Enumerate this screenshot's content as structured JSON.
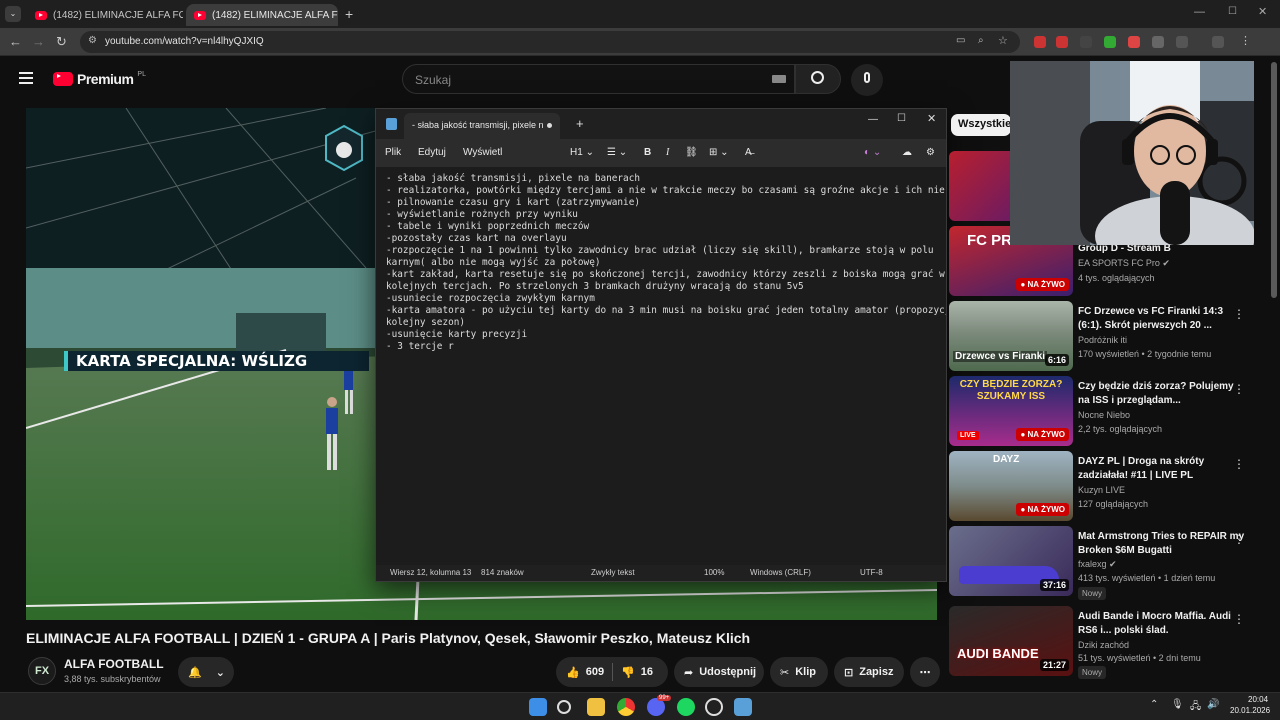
{
  "browser": {
    "tabs": [
      {
        "title": "(1482) ELIMINACJE ALFA FO",
        "active": false
      },
      {
        "title": "(1482) ELIMINACJE ALFA FOOTB",
        "active": true
      }
    ],
    "url": "youtube.com/watch?v=nl4lhyQJXIQ"
  },
  "youtube": {
    "logo": "Premium",
    "region": "PL",
    "search_placeholder": "Szukaj",
    "video_title": "ELIMINACJE ALFA FOOTBALL | DZIEŃ 1 - GRUPA A | Paris Platynov, Qesek, Sławomir Peszko, Mateusz Klich",
    "channel": {
      "name": "ALFA FOOTBALL",
      "subs": "3,88 tys. subskrybentów",
      "avatar_text": "FX"
    },
    "likes": "609",
    "dislikes": "16",
    "share_label": "Udostępnij",
    "clip_label": "Klip",
    "save_label": "Zapisz",
    "overlay_text": "KARTA SPECJALNA: WŚLIZG",
    "filter_chip": "Wszystkie"
  },
  "notepad": {
    "tab_title": "- słaba jakość transmisji, pixele n",
    "menu": [
      "Plik",
      "Edytuj",
      "Wyświetl"
    ],
    "heading_sel": "H1",
    "text": "- słaba jakość transmisji, pixele na banerach\n- realizatorka, powtórki między tercjami a nie w trakcie meczy bo czasami są groźne akcje i ich nie widać\n- pilnowanie czasu gry i kart (zatrzymywanie)\n- wyświetlanie rożnych przy wyniku\n- tabele i wyniki poprzednich meczów\n-pozostały czas kart na overlayu\n-rozpoczęcie 1 na 1 powinni tylko zawodnicy brac udział (liczy się skill), bramkarze stoją w polu\nkarnym( albo nie mogą wyjść za połowę)\n-kart zakład, karta resetuje się po skończonej tercji, zawodnicy którzy zeszli z boiska mogą grać w\nkolejnych tercjach. Po strzelonych 3 bramkach drużyny wracają do stanu 5v5\n-usuniecie rozpoczęcia zwykłym karnym\n-karta amatora - po użyciu tej karty do na 3 min musi na boisku grać jeden totalny amator (propozycja na\nkolejny sezon)\n-usunięcie karty precyzji\n- 3 tercje r",
    "status": {
      "position": "Wiersz 12, kolumna 13",
      "chars": "814 znaków",
      "format": "Zwykły tekst",
      "zoom": "100%",
      "eol": "Windows (CRLF)",
      "encoding": "UTF-8"
    }
  },
  "sidebar": [
    {
      "title": "Group D - Stream B",
      "channel": "EA SPORTS FC Pro",
      "verified": true,
      "meta": "4 tys. oglądających",
      "badge": "",
      "thumb_text": "FC PRO",
      "colors": [
        "#b81f2e",
        "#4a1a7a"
      ]
    },
    {
      "title": "FC Drzewce vs FC Firanki 14:3 (6:1). Skrót pierwszych 20 ...",
      "channel": "Podróżnik iti",
      "verified": false,
      "meta": "170 wyświetleń • 2 tygodnie temu",
      "badge": "6:16",
      "thumb_text": "Drzewce vs Firanki",
      "colors": [
        "#9aa89a",
        "#556655"
      ]
    },
    {
      "title": "Czy będzie dziś zorza? Polujemy na ISS i przeglądam...",
      "channel": "Nocne Niebo",
      "verified": false,
      "meta": "2,2 tys. oglądających",
      "badge": "NA ŻYWO",
      "thumb_text": "CZY BĘDZIE ZORZA? SZUKAMY ISS",
      "colors": [
        "#1d2a6b",
        "#a82c8c"
      ]
    },
    {
      "title": "DAYZ PL | Droga na skróty zadziałała! #11 | LIVE PL",
      "channel": "Kuzyn LIVE",
      "verified": false,
      "meta": "127 oglądających",
      "badge": "NA ŻYWO",
      "thumb_text": "DAYZ",
      "colors": [
        "#8aa0b0",
        "#6a5a3a"
      ]
    },
    {
      "title": "Mat Armstrong Tries to REPAIR my Broken $6M Bugatti",
      "channel": "fxalexg",
      "verified": true,
      "meta": "413 tys. wyświetleń • 1 dzień temu",
      "badge": "37:16",
      "new": "Nowy",
      "thumb_text": "",
      "colors": [
        "#6a6e8c",
        "#3a2a5a"
      ]
    },
    {
      "title": "Audi Bande i Mocro Maffia. Audi RS6 i... polski ślad.",
      "channel": "Dziki zachód",
      "verified": false,
      "meta": "51 tys. wyświetleń • 2 dni temu",
      "badge": "21:27",
      "new": "Nowy",
      "thumb_text": "AUDI BANDE",
      "colors": [
        "#2a2a2a",
        "#8a1a1a"
      ]
    }
  ],
  "taskbar": {
    "time": "20:04",
    "date": "20.01.2026",
    "notification_badge": "99+"
  }
}
